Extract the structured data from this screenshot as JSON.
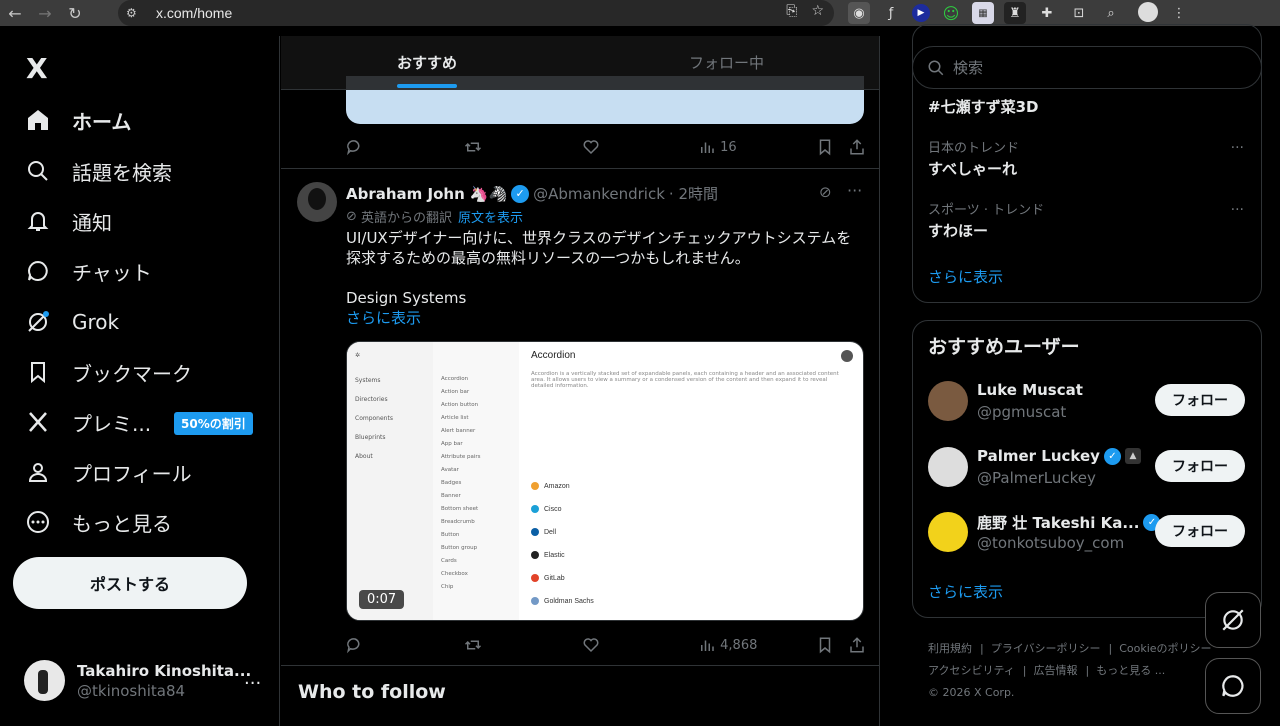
{
  "browser": {
    "url": "x.com/home"
  },
  "sidebar": {
    "logo": "X",
    "items": [
      {
        "label": "ホーム"
      },
      {
        "label": "話題を検索"
      },
      {
        "label": "通知"
      },
      {
        "label": "チャット"
      },
      {
        "label": "Grok"
      },
      {
        "label": "ブックマーク"
      },
      {
        "label": "プレミ..."
      },
      {
        "label": "プロフィール"
      },
      {
        "label": "もっと見る"
      }
    ],
    "premium_badge": "50%の割引",
    "post_button": "ポストする",
    "account": {
      "name": "Takahiro Kinoshita...",
      "handle": "@tkinoshita84",
      "more": "..."
    }
  },
  "timeline": {
    "tabs": [
      {
        "label": "おすすめ"
      },
      {
        "label": "フォロー中"
      }
    ],
    "prev_post": {
      "views": "16"
    },
    "post": {
      "name": "Abraham John",
      "emoji": "🦄🦓",
      "handle": "@Abmankendrick",
      "time": "· 2時間",
      "translate_note": "英語からの翻訳",
      "show_original": "原文を表示",
      "text1": "UI/UXデザイナー向けに、世界クラスのデザインチェックアウトシステムを探求するための最高の無料リソースの一つかもしれません。",
      "text2": "Design Systems",
      "show_more": "さらに表示",
      "video_time": "0:07",
      "views": "4,868",
      "media": {
        "sidebar": [
          "Systems",
          "Directories",
          "Components",
          "Blueprints",
          "About"
        ],
        "subnav": [
          "Accordion",
          "Action bar",
          "Action button",
          "Article list",
          "Alert banner",
          "App bar",
          "Attribute pairs",
          "Avatar",
          "Badges",
          "Banner",
          "Bottom sheet",
          "Breadcrumb",
          "Button",
          "Button group",
          "Cards",
          "Checkbox",
          "Chip"
        ],
        "heading": "Accordion",
        "desc": "Accordion is a vertically stacked set of expandable panels, each containing a header and an associated content area. It allows users to view a summary or a condensed version of the content and then expand it to reveal detailed information.",
        "companies": [
          {
            "name": "Amazon",
            "color": "#f0a030"
          },
          {
            "name": "Cisco",
            "color": "#1ba0d7"
          },
          {
            "name": "Dell",
            "color": "#0b5fa5"
          },
          {
            "name": "Elastic",
            "color": "#222222"
          },
          {
            "name": "GitLab",
            "color": "#e24329"
          },
          {
            "name": "Goldman Sachs",
            "color": "#7399c6"
          }
        ]
      }
    },
    "who_to_follow": "Who to follow"
  },
  "right": {
    "search_placeholder": "検索",
    "trends": [
      {
        "category": "",
        "title": "#七瀬すず菜3D"
      },
      {
        "category": "日本のトレンド",
        "title": "すべしゃーれ"
      },
      {
        "category": "スポーツ · トレンド",
        "title": "すわほー"
      }
    ],
    "trends_more": "さらに表示",
    "recommend_title": "おすすめユーザー",
    "users": [
      {
        "name": "Luke Muscat",
        "handle": "@pgmuscat",
        "follow": "フォロー"
      },
      {
        "name": "Palmer Luckey",
        "handle": "@PalmerLuckey",
        "follow": "フォロー"
      },
      {
        "name": "鹿野 壮 Takeshi Ka...",
        "handle": "@tonkotsuboy_com",
        "follow": "フォロー"
      }
    ],
    "users_more": "さらに表示",
    "footer": [
      "利用規約",
      "プライバシーポリシー",
      "Cookieのポリシー",
      "アクセシビリティ",
      "広告情報",
      "もっと見る ...",
      "© 2026 X Corp."
    ]
  }
}
